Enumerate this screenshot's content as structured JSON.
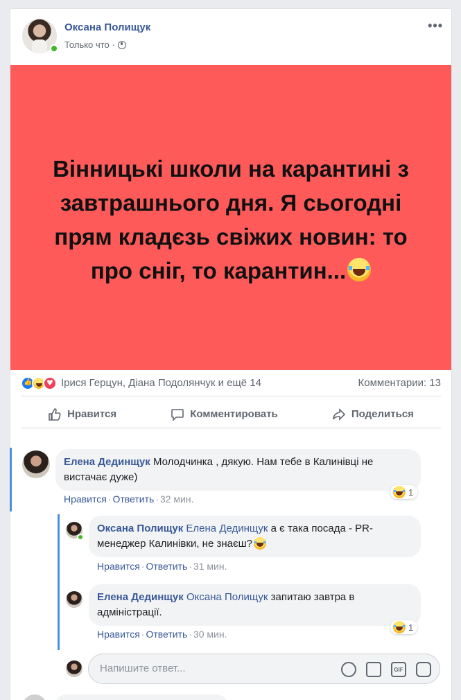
{
  "post": {
    "author": "Оксана Полищук",
    "time": "Только что",
    "text": "Вінницькі школи на карантині з завтрашнього дня. Я сьогодні прям кладєзь свіжих новин: то про сніг, то карантин...",
    "background_color": "#fe5a5a"
  },
  "reactions": {
    "icons": [
      "like-icon",
      "haha-icon",
      "love-icon"
    ],
    "names": "Ірися Герцун, Діана Подолянчук и ещё 14",
    "comments_count": "Комментарии: 13"
  },
  "actions": {
    "like": "Нравится",
    "comment": "Комментировать",
    "share": "Поделиться"
  },
  "comments": [
    {
      "author": "Елена Дединщук",
      "text": "Молодчинка , дякую. Нам тебе в Калинівці не вистачає дуже)",
      "like": "Нравится",
      "reply": "Ответить",
      "time": "32 мин.",
      "reaction_count": "1"
    },
    {
      "author": "Оксана Полищук",
      "tag": "Елена Дединщук",
      "text": "а є така посада - PR-менеджер Калинівки, не знаєш?",
      "like": "Нравится",
      "reply": "Ответить",
      "time": "31 мин."
    },
    {
      "author": "Елена Дединщук",
      "tag": "Оксана Полищук",
      "text": "запитаю завтра в адміністрації.",
      "like": "Нравится",
      "reply": "Ответить",
      "time": "30 мин.",
      "reaction_count": "1"
    }
  ],
  "reply_box": {
    "placeholder": "Напишите ответ...",
    "icons": [
      "emoji-icon",
      "camera-icon",
      "gif-icon",
      "sticker-icon"
    ],
    "gif_label": "GIF"
  },
  "more_label": "•••",
  "separator": "·",
  "link_color": "#385898",
  "accent_color": "#1877f2"
}
